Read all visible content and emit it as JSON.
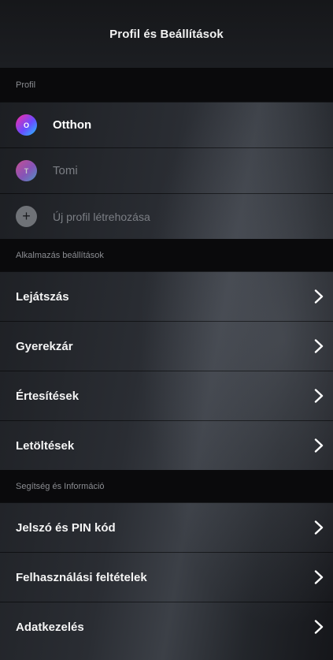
{
  "header": {
    "title": "Profil és Beállítások"
  },
  "profile_section": {
    "heading": "Profil",
    "profiles": [
      {
        "name": "Otthon",
        "initial": "O",
        "active": true
      },
      {
        "name": "Tomi",
        "initial": "T",
        "active": false
      }
    ],
    "add_profile": {
      "label": "Új profil létrehozása",
      "icon": "plus-icon",
      "glyph": "+"
    }
  },
  "app_settings": {
    "heading": "Alkalmazás beállítások",
    "items": [
      {
        "label": "Lejátszás"
      },
      {
        "label": "Gyerekzár"
      },
      {
        "label": "Értesítések"
      },
      {
        "label": "Letöltések"
      }
    ]
  },
  "help_section": {
    "heading": "Segítség és Információ",
    "items": [
      {
        "label": "Jelszó és PIN kód"
      },
      {
        "label": "Felhasználási feltételek"
      },
      {
        "label": "Adatkezelés"
      }
    ]
  },
  "colors": {
    "background": "#0b0c0e",
    "avatar_otthon": "#ff2aa0",
    "avatar_tomi": "#a865e8",
    "muted_text": "#7c7f85"
  }
}
